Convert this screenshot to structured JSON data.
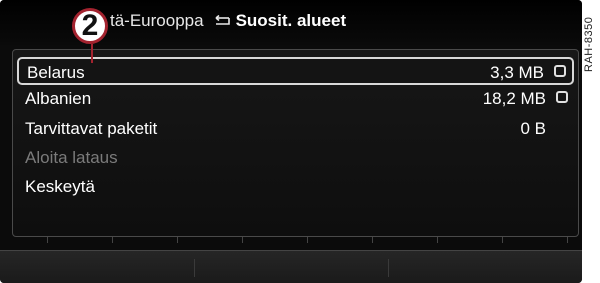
{
  "callout": {
    "number": "2"
  },
  "breadcrumb": {
    "parent": "tä-Eurooppa",
    "current": "Suosit. alueet"
  },
  "list": {
    "items": [
      {
        "label": "Belarus",
        "size": "3,3 MB",
        "checkbox": true,
        "selected": true
      },
      {
        "label": "Albanien",
        "size": "18,2 MB",
        "checkbox": true,
        "selected": false
      },
      {
        "label": "Tarvittavat paketit",
        "size": "0 B",
        "checkbox": false,
        "selected": false
      },
      {
        "label": "Aloita lataus",
        "disabled": true
      },
      {
        "label": "Keskeytä"
      }
    ]
  },
  "reference_code": "RAH-8350",
  "colors": {
    "accent": "#a3232f",
    "text": "#ffffff",
    "disabled_text": "#7b7b7b",
    "background": "#0b0b0b"
  },
  "icons": {
    "back": "back-arrow-icon",
    "checkbox": "checkbox-icon"
  }
}
